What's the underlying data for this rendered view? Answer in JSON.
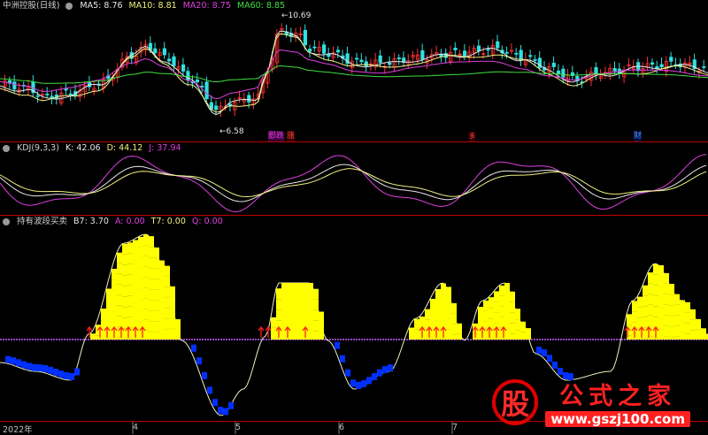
{
  "main_header": {
    "title": "中洲控股(日线)",
    "ma": [
      {
        "label": "MA5: 8.76",
        "color": "#e6e6e6"
      },
      {
        "label": "MA10: 8.81",
        "color": "#f0f080"
      },
      {
        "label": "MA20: 8.75",
        "color": "#e040e0"
      },
      {
        "label": "MA60: 8.85",
        "color": "#40e040"
      }
    ]
  },
  "kdj_header": {
    "title": "KDJ(9,3,3)",
    "items": [
      {
        "label": "K: 42.06",
        "color": "#e6e6e6"
      },
      {
        "label": "D: 44.12",
        "color": "#f0f080"
      },
      {
        "label": "J: 37.94",
        "color": "#e040e0"
      }
    ]
  },
  "ind_header": {
    "title": "持有波段买卖",
    "items": [
      {
        "label": "B7: 3.70",
        "color": "#e6e6e6"
      },
      {
        "label": "T7: 0.00",
        "color": "#f0f080"
      },
      {
        "label": "A: 0.00",
        "color": "#e040e0"
      },
      {
        "label": "T7: 0.00",
        "color": "#f0f080"
      },
      {
        "label": "Q: 0.00",
        "color": "#e040e0"
      }
    ]
  },
  "price_marks": {
    "high": "10.69",
    "low": "6.58"
  },
  "event_tags": [
    {
      "text": "郾跌",
      "color": "#e040e0",
      "bg": "#500050",
      "pos": "left"
    },
    {
      "text": "涨",
      "color": "#ff4040",
      "bg": "#400000",
      "pos": "mid1"
    },
    {
      "text": "多",
      "color": "#ff4040",
      "bg": "#400000",
      "pos": "mid2"
    },
    {
      "text": "财",
      "color": "#4080ff",
      "bg": "#001040",
      "pos": "right"
    }
  ],
  "time_axis": [
    "2022年",
    "4",
    "5",
    "6",
    "7"
  ],
  "watermark": {
    "logo": "股",
    "name": "公式之家",
    "url": "www.gszj100.com"
  },
  "colors": {
    "up": "#ff3030",
    "down": "#30e0e0",
    "buy": "#ffff00",
    "sell": "#0030ff",
    "grid": "#c00000"
  }
}
